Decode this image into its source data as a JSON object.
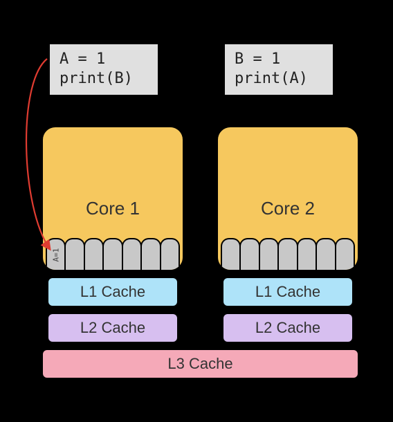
{
  "code_left": {
    "line1": "A = 1",
    "line2": "print(B)"
  },
  "code_right": {
    "line1": "B = 1",
    "line2": "print(A)"
  },
  "core1": {
    "label": "Core 1"
  },
  "core2": {
    "label": "Core 2"
  },
  "buffer_entry": "A=1",
  "caches": {
    "l1": "L1 Cache",
    "l2": "L2 Cache",
    "l3": "L3 Cache"
  },
  "colors": {
    "core": "#f6c85e",
    "buffer": "#c8c8c8",
    "l1": "#aee3f9",
    "l2": "#d7bff0",
    "l3": "#f5a9b8",
    "arrow": "#e03c31"
  }
}
